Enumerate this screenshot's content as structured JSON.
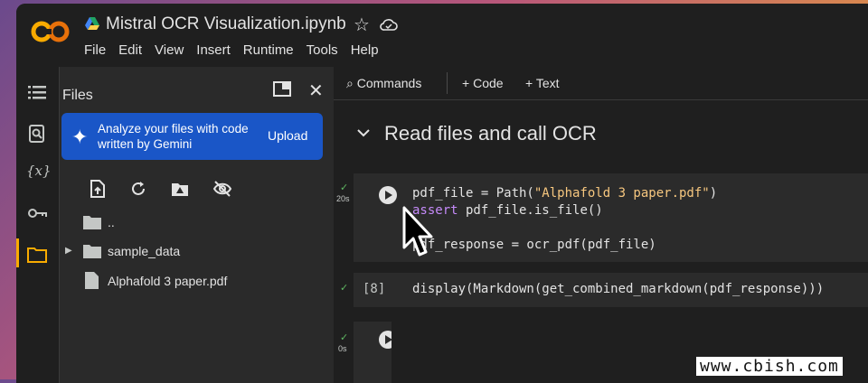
{
  "app": {
    "notebook_title": "Mistral OCR Visualization.ipynb",
    "logo_text": "CO",
    "menu": [
      "File",
      "Edit",
      "View",
      "Insert",
      "Runtime",
      "Tools",
      "Help"
    ]
  },
  "rail": {
    "icons": [
      "toc-icon",
      "find-icon",
      "variables-icon",
      "secrets-icon",
      "files-icon"
    ],
    "variables_label": "{x}"
  },
  "files_panel": {
    "title": "Files",
    "banner_text": "Analyze your files with code written by Gemini",
    "banner_action": "Upload",
    "tree": [
      {
        "label": "..",
        "type": "folder",
        "expandable": false
      },
      {
        "label": "sample_data",
        "type": "folder",
        "expandable": true
      },
      {
        "label": "Alphafold 3 paper.pdf",
        "type": "file",
        "expandable": false
      }
    ]
  },
  "toolbar": {
    "commands": "Commands",
    "add_code": "Code",
    "add_text": "Text"
  },
  "section": {
    "title": "Read files and call OCR"
  },
  "cells": [
    {
      "time": "20s",
      "status": "✓",
      "lines": {
        "l1_a": "pdf_file = Path(",
        "l1_str": "\"Alphafold 3 paper.pdf\"",
        "l1_b": ")",
        "l2_kw": "assert",
        "l2_b": " pdf_file.is_file()",
        "l3": "pdf_response = ocr_pdf(pdf_file)"
      }
    },
    {
      "exec_count": "[8]",
      "status": "✓",
      "code": "display(Markdown(get_combined_markdown(pdf_response)))"
    },
    {
      "time": "0s",
      "status": "✓"
    }
  ],
  "watermark": "www.cbish.com",
  "colors": {
    "accent_blue": "#1a56c7",
    "keyword": "#c58af9",
    "string": "#f7c77f",
    "success": "#5fb762",
    "logo_orange": "#f9ab00"
  }
}
